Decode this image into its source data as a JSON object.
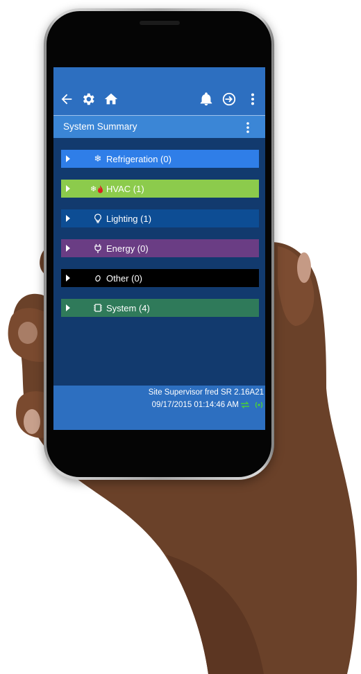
{
  "screen": {
    "header": {
      "back_icon": "arrow-left-icon",
      "settings_icon": "gear-icon",
      "home_icon": "home-icon",
      "alarm_icon": "bell-icon",
      "logout_icon": "logout-icon",
      "menu_icon": "more-vertical-icon"
    },
    "sub_header": {
      "title": "System Summary",
      "menu_icon": "more-vertical-icon"
    },
    "categories": [
      {
        "label": "Refrigeration (0)",
        "icon": "snowflake-icon",
        "color": "#2f7ee8"
      },
      {
        "label": "HVAC (1)",
        "icon": "hvac-icon",
        "color": "#8ccb4c"
      },
      {
        "label": "Lighting (1)",
        "icon": "lightbulb-icon",
        "color": "#0d4d94"
      },
      {
        "label": "Energy (0)",
        "icon": "plug-icon",
        "color": "#6a3d84"
      },
      {
        "label": "Other (0)",
        "icon": "other-icon",
        "color": "#000000"
      },
      {
        "label": "System (4)",
        "icon": "chip-icon",
        "color": "#2f7a5a"
      }
    ],
    "footer": {
      "site_info": "Site Supervisor fred SR 2.16A21",
      "timestamp": "09/17/2015 01:14:46 AM",
      "sync_icon": "sync-arrows-icon",
      "connection_icon": "connection-icon",
      "status_color": "#4cd137"
    }
  }
}
